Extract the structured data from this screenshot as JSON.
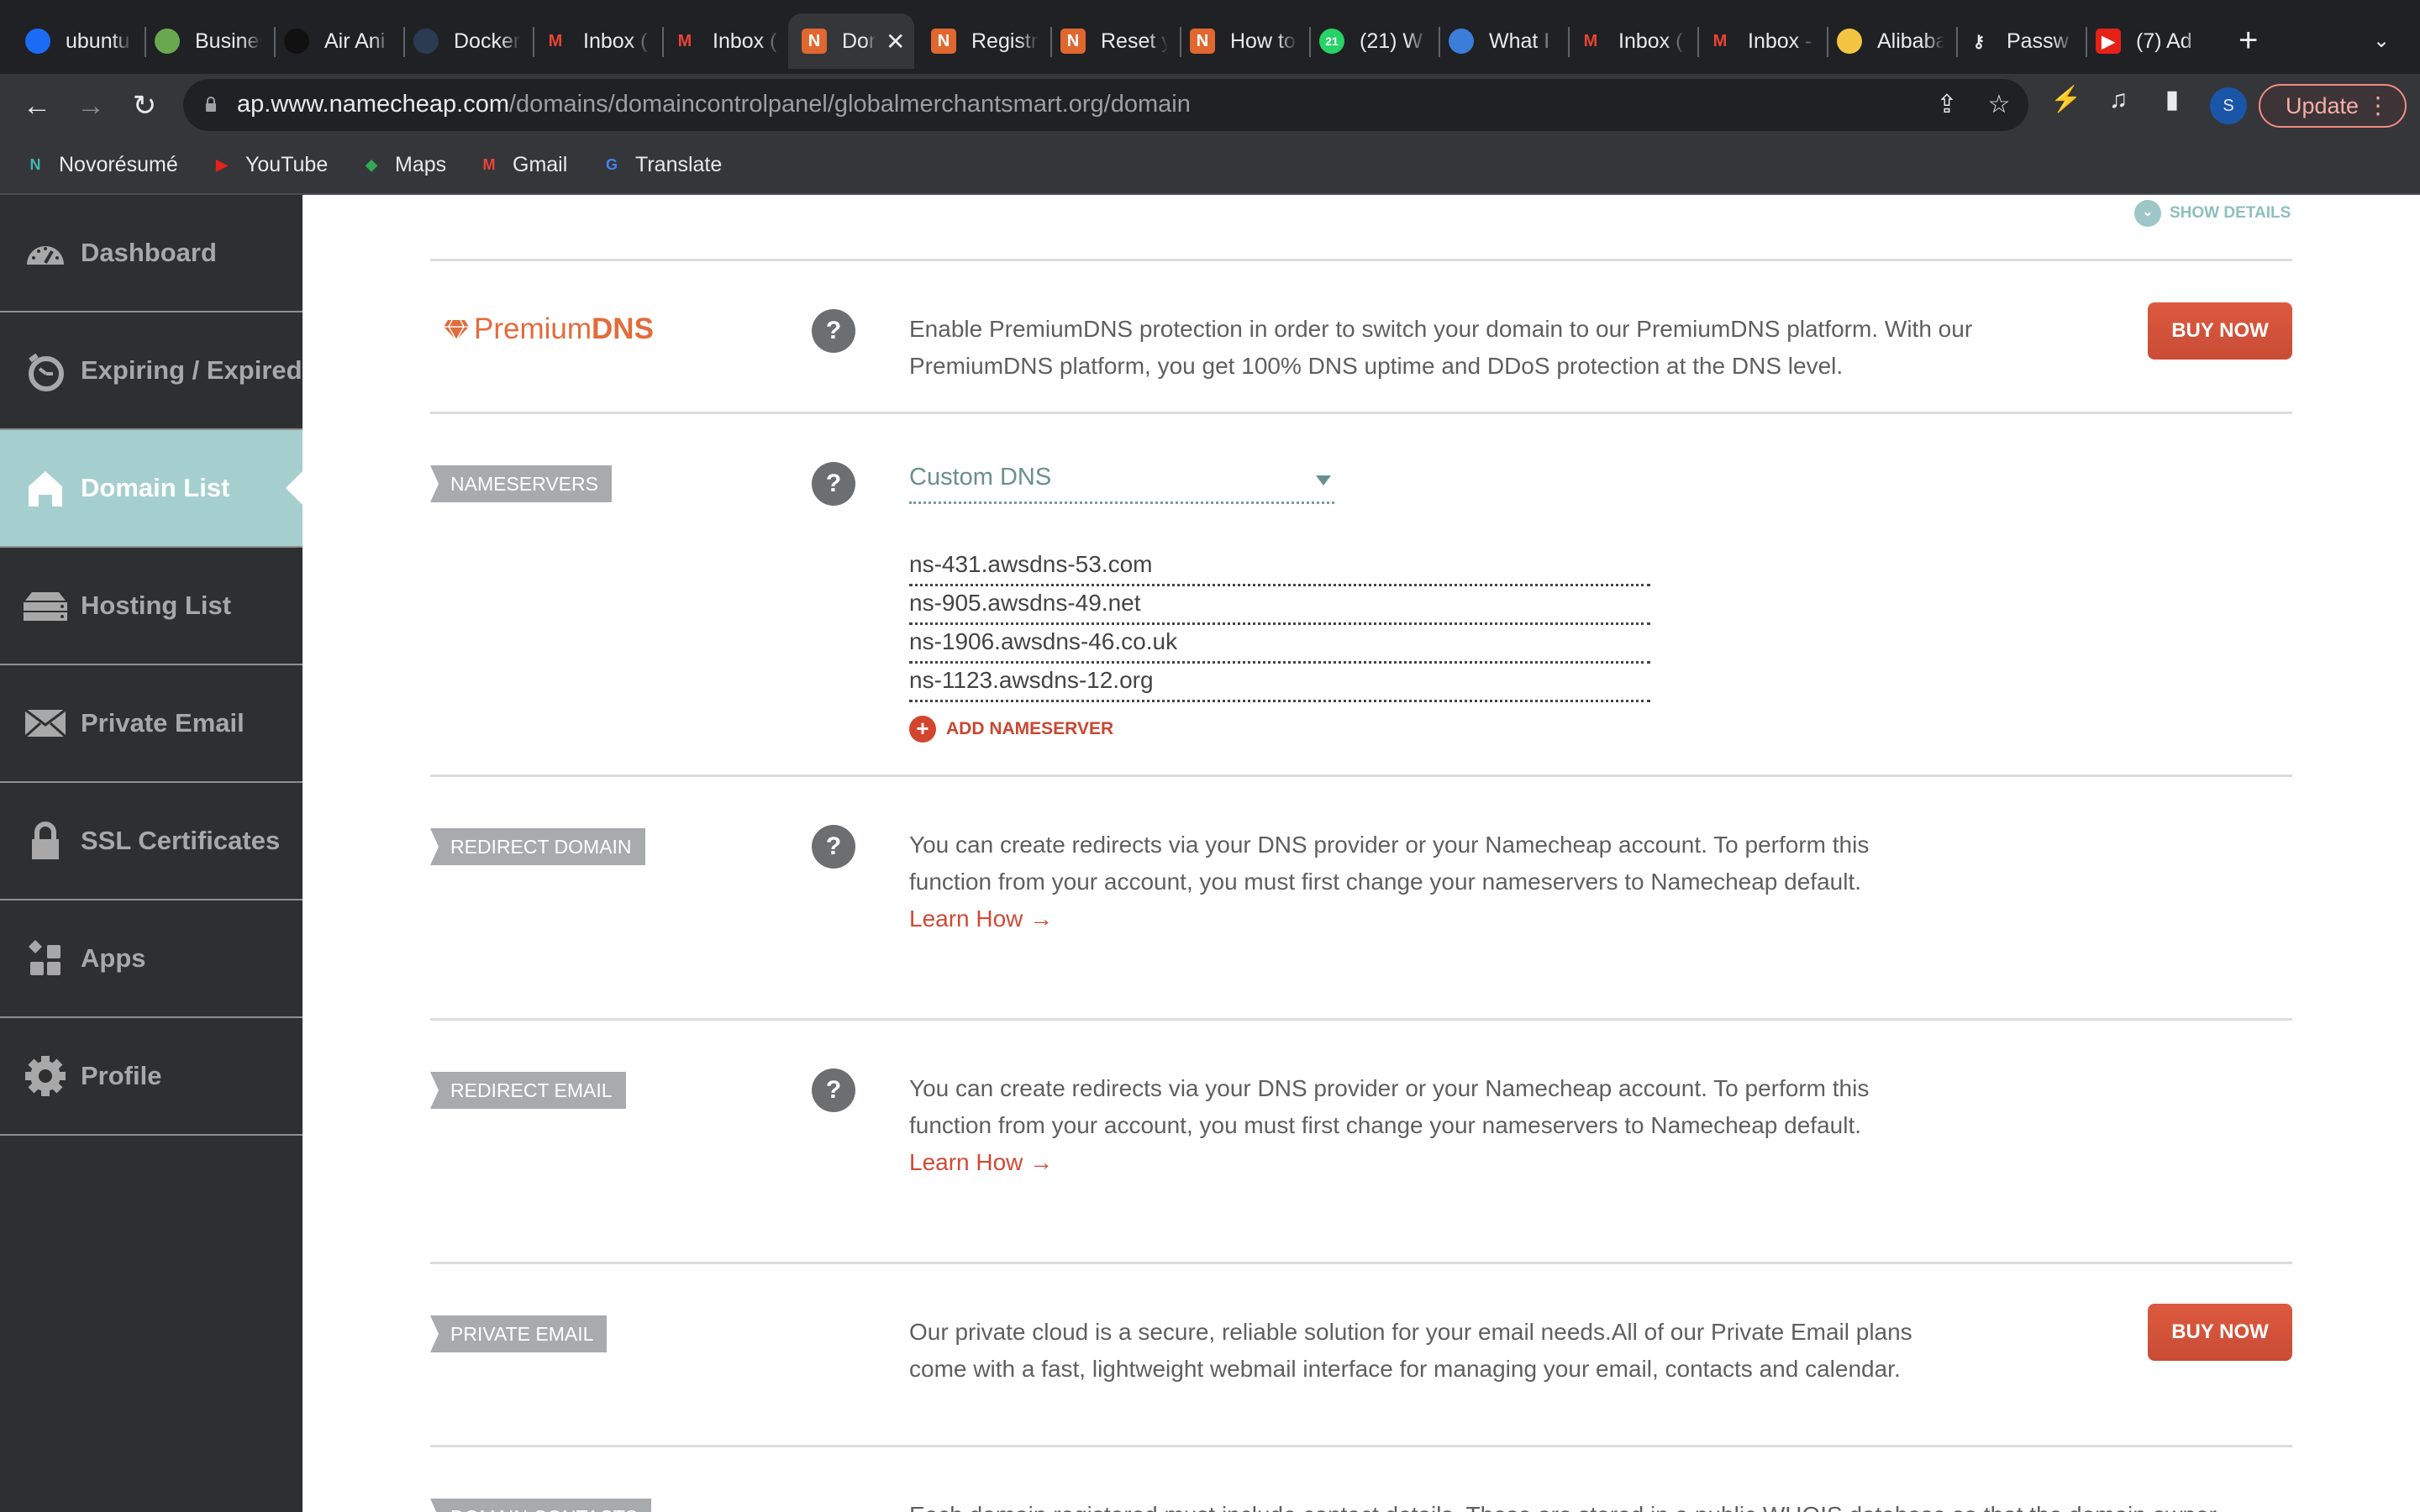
{
  "browser": {
    "tabs": [
      {
        "title": "ubuntu",
        "icon": "digitalocean-icon",
        "color": "#1c6bf5"
      },
      {
        "title": "Business",
        "icon": "business-icon",
        "color": "#6aa84f"
      },
      {
        "title": "Air Ani",
        "icon": "air-icon",
        "color": "#111111"
      },
      {
        "title": "Docker",
        "icon": "docker-icon",
        "color": "#2a3b52"
      },
      {
        "title": "Inbox (",
        "icon": "gmail-icon",
        "color": "#ea4335"
      },
      {
        "title": "Inbox (",
        "icon": "gmail-icon",
        "color": "#ea4335"
      },
      {
        "title": "Domain",
        "icon": "namecheap-icon",
        "color": "#e0672f",
        "active": true
      },
      {
        "title": "Registr",
        "icon": "namecheap-icon",
        "color": "#e0672f"
      },
      {
        "title": "Reset y",
        "icon": "namecheap-icon",
        "color": "#e0672f"
      },
      {
        "title": "How to",
        "icon": "namecheap-icon",
        "color": "#e0672f"
      },
      {
        "title": "(21) W",
        "icon": "whatsapp-icon",
        "color": "#25d366",
        "badge": "21"
      },
      {
        "title": "What I",
        "icon": "globe-icon",
        "color": "#3b7dd8"
      },
      {
        "title": "Inbox (",
        "icon": "gmail-icon",
        "color": "#ea4335"
      },
      {
        "title": "Inbox -",
        "icon": "gmail-icon",
        "color": "#ea4335"
      },
      {
        "title": "Alibaba",
        "icon": "alibaba-icon",
        "color": "#f4c542"
      },
      {
        "title": "Passw",
        "icon": "key-icon",
        "color": "#e8eaed"
      },
      {
        "title": "(7) Ad",
        "icon": "youtube-icon",
        "color": "#e62117"
      }
    ],
    "new_tab": "+",
    "tab_menu": "⌄",
    "url_host": "ap.www.namecheap.com",
    "url_path": "/domains/domaincontrolpanel/globalmerchantsmart.org/domain",
    "profile_initial": "S",
    "update_label": "Update",
    "bookmarks": [
      {
        "label": "Novorésumé",
        "icon": "novoresume-icon",
        "color": "#3fb6b2",
        "glyph": "N"
      },
      {
        "label": "YouTube",
        "icon": "youtube-icon",
        "color": "#e62117",
        "glyph": "▶"
      },
      {
        "label": "Maps",
        "icon": "maps-icon",
        "color": "#34a853",
        "glyph": "◆"
      },
      {
        "label": "Gmail",
        "icon": "gmail-icon",
        "color": "#ea4335",
        "glyph": "M"
      },
      {
        "label": "Translate",
        "icon": "translate-icon",
        "color": "#4285f4",
        "glyph": "G"
      }
    ]
  },
  "sidebar": {
    "items": [
      {
        "label": "Dashboard",
        "icon": "dashboard-gauge-icon"
      },
      {
        "label": "Expiring / Expired",
        "icon": "stopwatch-icon"
      },
      {
        "label": "Domain List",
        "icon": "home-icon",
        "active": true
      },
      {
        "label": "Hosting List",
        "icon": "server-icon"
      },
      {
        "label": "Private Email",
        "icon": "envelope-icon"
      },
      {
        "label": "SSL Certificates",
        "icon": "lock-icon"
      },
      {
        "label": "Apps",
        "icon": "apps-icon"
      },
      {
        "label": "Profile",
        "icon": "gear-icon"
      }
    ]
  },
  "main": {
    "show_details": "SHOW DETAILS",
    "premium_dns": {
      "logo_light": "Premium",
      "logo_bold": "DNS",
      "help": "?",
      "text": "Enable PremiumDNS protection in order to switch your domain to our PremiumDNS platform. With our PremiumDNS platform, you get 100% DNS uptime and DDoS protection at the DNS level.",
      "button": "BUY NOW"
    },
    "nameservers": {
      "label": "NAMESERVERS",
      "help": "?",
      "selected": "Custom DNS",
      "entries": [
        "ns-431.awsdns-53.com",
        "ns-905.awsdns-49.net",
        "ns-1906.awsdns-46.co.uk",
        "ns-1123.awsdns-12.org"
      ],
      "add_label": "ADD NAMESERVER"
    },
    "redirect_domain": {
      "label": "REDIRECT DOMAIN",
      "help": "?",
      "text": "You can create redirects via your DNS provider or your Namecheap account. To perform this function from your account, you must first change your nameservers to Namecheap default.",
      "link": "Learn How →"
    },
    "redirect_email": {
      "label": "REDIRECT EMAIL",
      "help": "?",
      "text": "You can create redirects via your DNS provider or your Namecheap account. To perform this function from your account, you must first change your nameservers to Namecheap default.",
      "link": "Learn How →"
    },
    "private_email": {
      "label": "PRIVATE EMAIL",
      "text": "Our private cloud is a secure, reliable solution for your email needs.All of our Private Email plans come with a fast, lightweight webmail interface for managing your email, contacts and calendar.",
      "button": "BUY NOW"
    },
    "domain_contacts": {
      "label": "DOMAIN CONTACTS",
      "text": "Each domain registered must include contact details. These are stored in a public WHOIS database so that the domain owner"
    }
  }
}
